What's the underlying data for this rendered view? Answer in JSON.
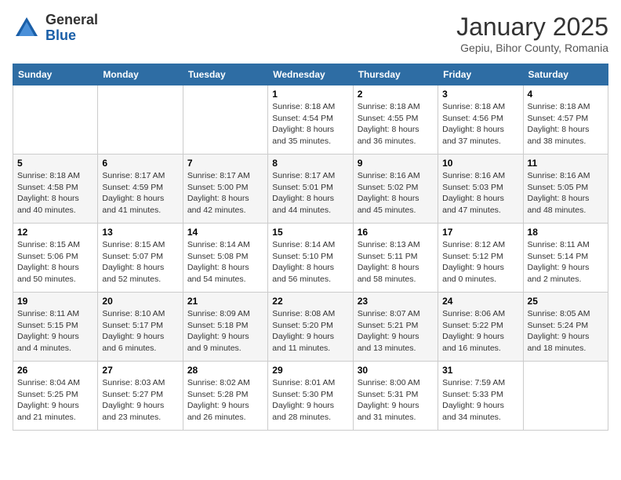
{
  "header": {
    "logo_general": "General",
    "logo_blue": "Blue",
    "month_title": "January 2025",
    "location": "Gepiu, Bihor County, Romania"
  },
  "days_of_week": [
    "Sunday",
    "Monday",
    "Tuesday",
    "Wednesday",
    "Thursday",
    "Friday",
    "Saturday"
  ],
  "weeks": [
    [
      {
        "day": "",
        "info": ""
      },
      {
        "day": "",
        "info": ""
      },
      {
        "day": "",
        "info": ""
      },
      {
        "day": "1",
        "info": "Sunrise: 8:18 AM\nSunset: 4:54 PM\nDaylight: 8 hours and 35 minutes."
      },
      {
        "day": "2",
        "info": "Sunrise: 8:18 AM\nSunset: 4:55 PM\nDaylight: 8 hours and 36 minutes."
      },
      {
        "day": "3",
        "info": "Sunrise: 8:18 AM\nSunset: 4:56 PM\nDaylight: 8 hours and 37 minutes."
      },
      {
        "day": "4",
        "info": "Sunrise: 8:18 AM\nSunset: 4:57 PM\nDaylight: 8 hours and 38 minutes."
      }
    ],
    [
      {
        "day": "5",
        "info": "Sunrise: 8:18 AM\nSunset: 4:58 PM\nDaylight: 8 hours and 40 minutes."
      },
      {
        "day": "6",
        "info": "Sunrise: 8:17 AM\nSunset: 4:59 PM\nDaylight: 8 hours and 41 minutes."
      },
      {
        "day": "7",
        "info": "Sunrise: 8:17 AM\nSunset: 5:00 PM\nDaylight: 8 hours and 42 minutes."
      },
      {
        "day": "8",
        "info": "Sunrise: 8:17 AM\nSunset: 5:01 PM\nDaylight: 8 hours and 44 minutes."
      },
      {
        "day": "9",
        "info": "Sunrise: 8:16 AM\nSunset: 5:02 PM\nDaylight: 8 hours and 45 minutes."
      },
      {
        "day": "10",
        "info": "Sunrise: 8:16 AM\nSunset: 5:03 PM\nDaylight: 8 hours and 47 minutes."
      },
      {
        "day": "11",
        "info": "Sunrise: 8:16 AM\nSunset: 5:05 PM\nDaylight: 8 hours and 48 minutes."
      }
    ],
    [
      {
        "day": "12",
        "info": "Sunrise: 8:15 AM\nSunset: 5:06 PM\nDaylight: 8 hours and 50 minutes."
      },
      {
        "day": "13",
        "info": "Sunrise: 8:15 AM\nSunset: 5:07 PM\nDaylight: 8 hours and 52 minutes."
      },
      {
        "day": "14",
        "info": "Sunrise: 8:14 AM\nSunset: 5:08 PM\nDaylight: 8 hours and 54 minutes."
      },
      {
        "day": "15",
        "info": "Sunrise: 8:14 AM\nSunset: 5:10 PM\nDaylight: 8 hours and 56 minutes."
      },
      {
        "day": "16",
        "info": "Sunrise: 8:13 AM\nSunset: 5:11 PM\nDaylight: 8 hours and 58 minutes."
      },
      {
        "day": "17",
        "info": "Sunrise: 8:12 AM\nSunset: 5:12 PM\nDaylight: 9 hours and 0 minutes."
      },
      {
        "day": "18",
        "info": "Sunrise: 8:11 AM\nSunset: 5:14 PM\nDaylight: 9 hours and 2 minutes."
      }
    ],
    [
      {
        "day": "19",
        "info": "Sunrise: 8:11 AM\nSunset: 5:15 PM\nDaylight: 9 hours and 4 minutes."
      },
      {
        "day": "20",
        "info": "Sunrise: 8:10 AM\nSunset: 5:17 PM\nDaylight: 9 hours and 6 minutes."
      },
      {
        "day": "21",
        "info": "Sunrise: 8:09 AM\nSunset: 5:18 PM\nDaylight: 9 hours and 9 minutes."
      },
      {
        "day": "22",
        "info": "Sunrise: 8:08 AM\nSunset: 5:20 PM\nDaylight: 9 hours and 11 minutes."
      },
      {
        "day": "23",
        "info": "Sunrise: 8:07 AM\nSunset: 5:21 PM\nDaylight: 9 hours and 13 minutes."
      },
      {
        "day": "24",
        "info": "Sunrise: 8:06 AM\nSunset: 5:22 PM\nDaylight: 9 hours and 16 minutes."
      },
      {
        "day": "25",
        "info": "Sunrise: 8:05 AM\nSunset: 5:24 PM\nDaylight: 9 hours and 18 minutes."
      }
    ],
    [
      {
        "day": "26",
        "info": "Sunrise: 8:04 AM\nSunset: 5:25 PM\nDaylight: 9 hours and 21 minutes."
      },
      {
        "day": "27",
        "info": "Sunrise: 8:03 AM\nSunset: 5:27 PM\nDaylight: 9 hours and 23 minutes."
      },
      {
        "day": "28",
        "info": "Sunrise: 8:02 AM\nSunset: 5:28 PM\nDaylight: 9 hours and 26 minutes."
      },
      {
        "day": "29",
        "info": "Sunrise: 8:01 AM\nSunset: 5:30 PM\nDaylight: 9 hours and 28 minutes."
      },
      {
        "day": "30",
        "info": "Sunrise: 8:00 AM\nSunset: 5:31 PM\nDaylight: 9 hours and 31 minutes."
      },
      {
        "day": "31",
        "info": "Sunrise: 7:59 AM\nSunset: 5:33 PM\nDaylight: 9 hours and 34 minutes."
      },
      {
        "day": "",
        "info": ""
      }
    ]
  ]
}
